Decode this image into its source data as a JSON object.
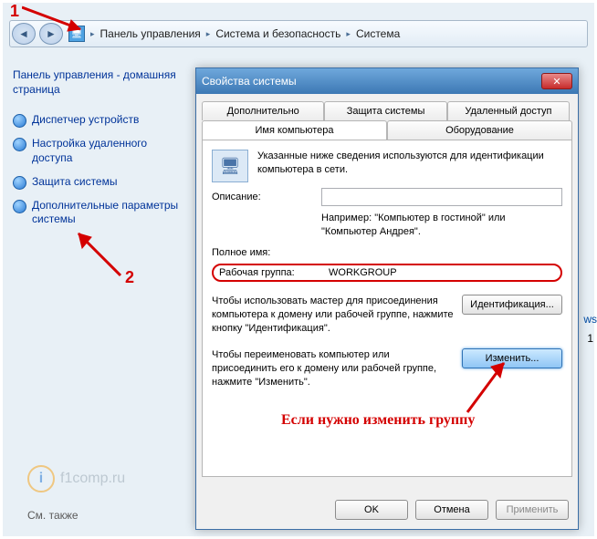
{
  "breadcrumb": {
    "root_icon": "computer-icon",
    "items": [
      "Панель управления",
      "Система и безопасность",
      "Система"
    ]
  },
  "sidebar": {
    "home_label": "Панель управления - домашняя страница",
    "links": [
      "Диспетчер устройств",
      "Настройка удаленного доступа",
      "Защита системы",
      "Дополнительные параметры системы"
    ],
    "see_also": "См. также"
  },
  "dialog": {
    "title": "Свойства системы",
    "tabs_row1": [
      "Дополнительно",
      "Защита системы",
      "Удаленный доступ"
    ],
    "tabs_row2": [
      "Имя компьютера",
      "Оборудование"
    ],
    "active_tab": "Имя компьютера",
    "intro": "Указанные ниже сведения используются для идентификации компьютера в сети.",
    "desc_label": "Описание:",
    "desc_placeholder": "",
    "example": "Например: \"Компьютер в гостиной\" или \"Компьютер Андрея\".",
    "fullname_label": "Полное имя:",
    "fullname_value": "",
    "workgroup_label": "Рабочая группа:",
    "workgroup_value": "WORKGROUP",
    "identify_text": "Чтобы использовать мастер для присоединения компьютера к домену или рабочей группе, нажмите кнопку \"Идентификация\".",
    "identify_btn": "Идентификация...",
    "change_text": "Чтобы переименовать компьютер или присоединить его к домену или рабочей группе, нажмите \"Изменить\".",
    "change_btn": "Изменить...",
    "ok": "OK",
    "cancel": "Отмена",
    "apply": "Применить"
  },
  "annotations": {
    "n1": "1",
    "n2": "2",
    "hint": "Если нужно изменить группу"
  },
  "watermark": {
    "logo_letter": "i",
    "text": "f1comp.ru"
  },
  "extra": {
    "ws": "ws",
    "one": "1"
  }
}
